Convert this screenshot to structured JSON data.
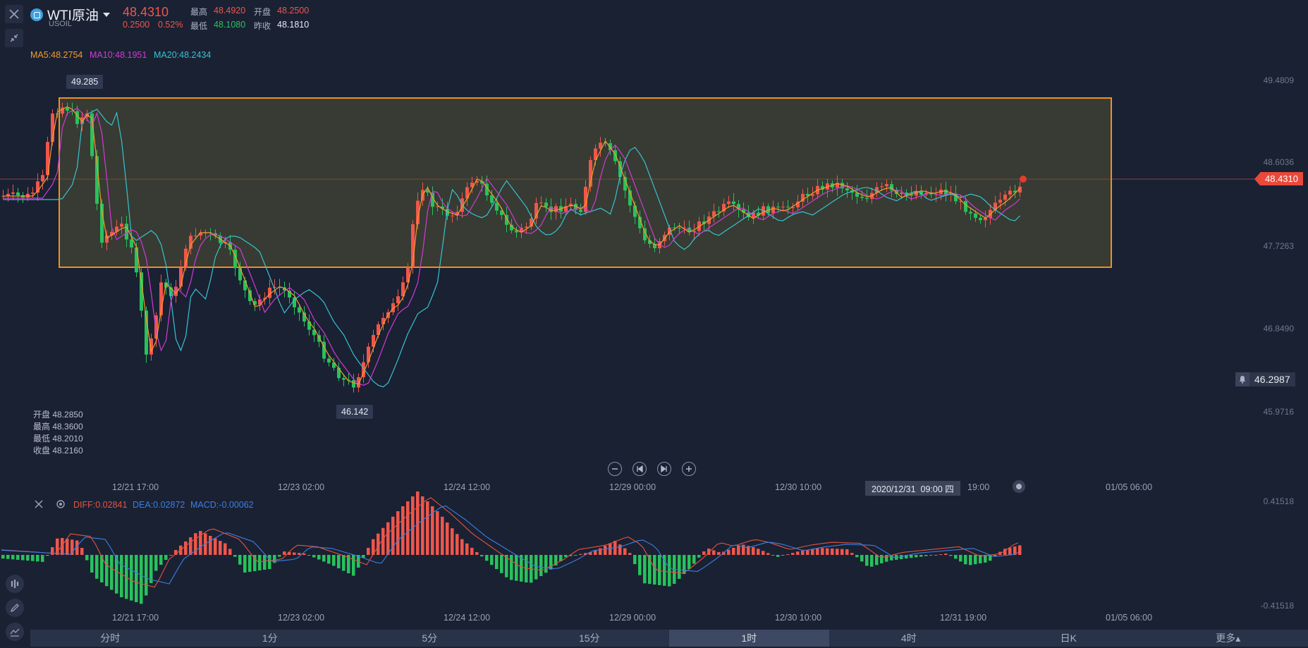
{
  "header": {
    "symbol": "WTI原油",
    "code": "USOIL",
    "price": "48.4310",
    "change": "0.2500",
    "change_pct": "0.52%",
    "high_label": "最高",
    "high": "48.4920",
    "open_label": "开盘",
    "open": "48.2500",
    "low_label": "最低",
    "low": "48.1080",
    "prev_label": "昨收",
    "prev": "48.1810"
  },
  "ma": {
    "ma5": "MA5:48.2754",
    "ma10": "MA10:48.1951",
    "ma20": "MA20:48.2434"
  },
  "ohlc_panel": {
    "open": "开盘 48.2850",
    "high": "最高 48.3600",
    "low": "最低 48.2010",
    "close": "收盘 48.2160"
  },
  "tooltips": {
    "max": "49.285",
    "min": "46.142"
  },
  "y_axis": [
    "49.4809",
    "48.6036",
    "47.7263",
    "46.8490",
    "45.9716"
  ],
  "price_tag": "48.4310",
  "alert_price": "46.2987",
  "x_axis_main": [
    "12/21 17:00",
    "12/23 02:00",
    "12/24 12:00",
    "12/29 00:00",
    "12/30 10:00",
    "19:00",
    "01/05 06:00"
  ],
  "crosshair_time": "2020/12/31  09:00 四",
  "macd": {
    "diff": "DIFF:0.02841",
    "dea": "DEA:0.02872",
    "macd": "MACD:-0.00062",
    "y_top": "0.41518",
    "y_bottom": "-0.41518"
  },
  "x_axis_macd": [
    "12/21 17:00",
    "12/23 02:00",
    "12/24 12:00",
    "12/29 00:00",
    "12/30 10:00",
    "12/31 19:00",
    "01/05 06:00"
  ],
  "timeframes": [
    "分时",
    "1分",
    "5分",
    "15分",
    "1时",
    "4时",
    "日K",
    "更多▴"
  ],
  "active_timeframe": "1时",
  "colors": {
    "up": "#f0564b",
    "down": "#28c25b",
    "ma5": "#f39c2b",
    "ma10": "#d13ad6",
    "ma20": "#36c3d1",
    "diff": "#e4533f",
    "dea": "#3b7fe4",
    "box": "#f0901e"
  }
}
